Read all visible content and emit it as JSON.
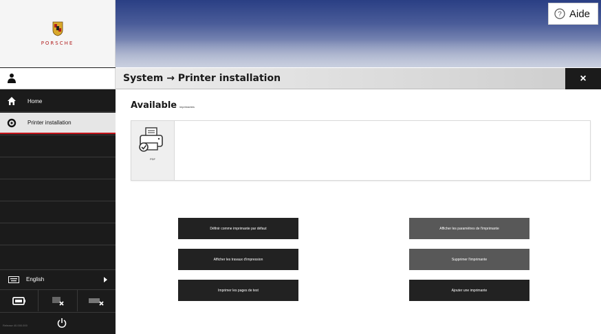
{
  "brand": {
    "name": "PORSCHE"
  },
  "help": {
    "label": "Aide",
    "icon": "help-circle-icon"
  },
  "titlebar": {
    "title": "System → Printer installation",
    "close_label": "×"
  },
  "sidebar": {
    "items": [
      {
        "label": "Home",
        "icon": "home-icon"
      },
      {
        "label": "Printer installation",
        "icon": "gear-icon"
      }
    ],
    "language": {
      "label": "English",
      "icon": "keyboard-icon"
    },
    "tools": [
      {
        "icon": "battery-icon"
      },
      {
        "icon": "device-disconnect-icon"
      },
      {
        "icon": "vehicle-disconnect-icon"
      }
    ],
    "footer_text": "Release 40.000.000",
    "power_icon": "power-icon"
  },
  "main": {
    "available_title": "Available",
    "available_subtitle": "imprimantes",
    "printers": [
      {
        "label": "PDF",
        "icon": "printer-check-icon"
      }
    ],
    "actions_left": [
      "Définir comme imprimante par défaut",
      "Afficher les travaux d'impression",
      "Imprimer les pages de test"
    ],
    "actions_right": [
      "Afficher les paramètres de l'imprimante",
      "Supprimer l'imprimante",
      "Ajouter une imprimante"
    ]
  },
  "colors": {
    "accent_red": "#c6151b",
    "sidebar_dark": "#1b1b1b",
    "button_dark": "#222222",
    "button_grey": "#585858"
  }
}
